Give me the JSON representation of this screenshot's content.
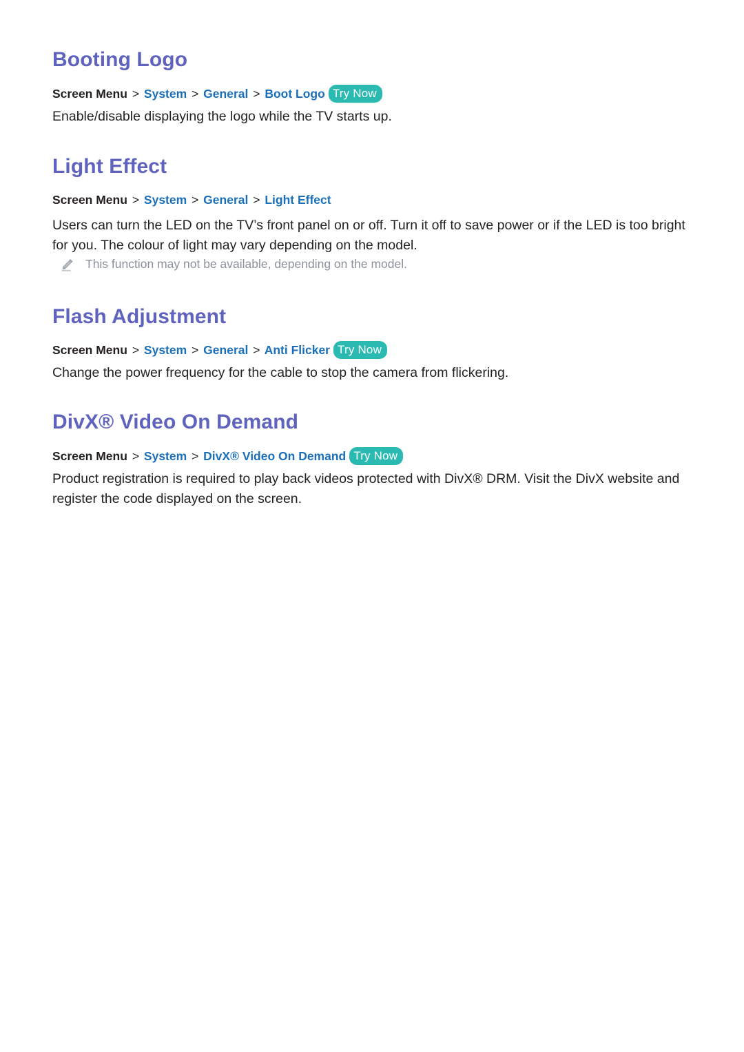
{
  "document": {
    "page_background": "#ffffff",
    "heading_color": "#5f63be",
    "link_color": "#1a6fb8",
    "body_color": "#222222",
    "note_color": "#8b919c",
    "badge_color": "#2bbab2"
  },
  "sections": [
    {
      "id": "booting-logo",
      "heading": "Booting Logo",
      "breadcrumb": {
        "root": "Screen Menu",
        "separator": ">",
        "links": [
          "System",
          "General",
          "Boot Logo"
        ],
        "badge": "Try Now"
      },
      "body": "Enable/disable displaying the logo while the TV starts up.",
      "note": null
    },
    {
      "id": "light-effect",
      "heading": "Light Effect",
      "breadcrumb": {
        "root": "Screen Menu",
        "separator": ">",
        "links": [
          "System",
          "General",
          "Light Effect"
        ],
        "badge": null
      },
      "body": "Users can turn the LED on the TV’s front panel on or off. Turn it off to save power or if the LED is too bright for you. The colour of light may vary depending on the model.",
      "note": {
        "icon": "pencil-icon",
        "text": "This function may not be available, depending on the model."
      }
    },
    {
      "id": "flash-adjustment",
      "heading": "Flash Adjustment",
      "breadcrumb": {
        "root": "Screen Menu",
        "separator": ">",
        "links": [
          "System",
          "General",
          "Anti Flicker"
        ],
        "badge": "Try Now"
      },
      "body": "Change the power frequency for the cable to stop the camera from flickering.",
      "note": null
    },
    {
      "id": "divx-video-on-demand",
      "heading": "DivX® Video On Demand",
      "breadcrumb": {
        "root": "Screen Menu",
        "separator": ">",
        "links": [
          "System",
          "DivX® Video On Demand"
        ],
        "badge": "Try Now"
      },
      "body": "Product registration is required to play back videos protected with DivX® DRM. Visit the DivX website and register the code displayed on the screen.",
      "note": null
    }
  ]
}
